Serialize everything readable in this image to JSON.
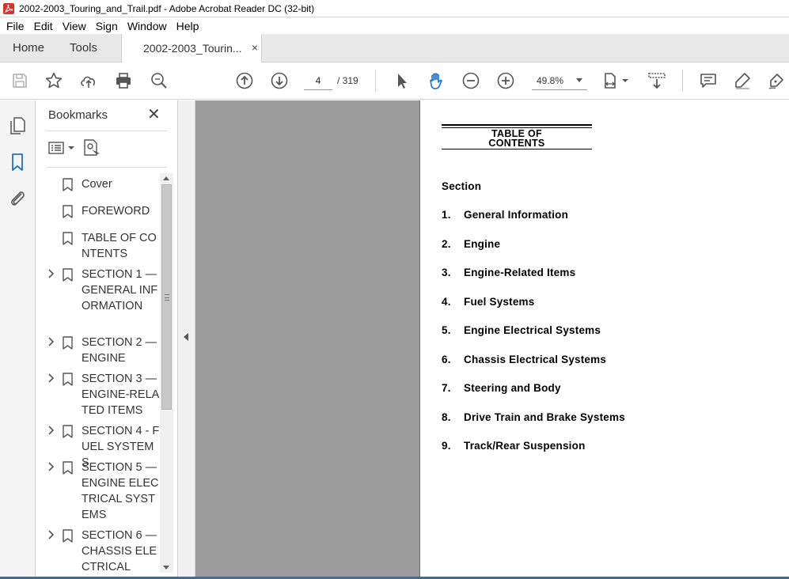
{
  "window": {
    "title": "2002-2003_Touring_and_Trail.pdf - Adobe Acrobat Reader DC (32-bit)"
  },
  "menu": {
    "items": [
      "File",
      "Edit",
      "View",
      "Sign",
      "Window",
      "Help"
    ]
  },
  "tabs": {
    "home": "Home",
    "tools": "Tools",
    "document": "2002-2003_Tourin...",
    "close": "×"
  },
  "toolbar": {
    "current_page": "4",
    "total_pages": "/ 319",
    "zoom": "49.8%"
  },
  "bookmarks": {
    "header": "Bookmarks",
    "close": "✕",
    "items": [
      {
        "label": "Cover"
      },
      {
        "label": "FOREWORD"
      },
      {
        "label": "TABLE OF CONTENTS"
      },
      {
        "label": "SECTION 1 — GENERAL INFORMATION"
      },
      {
        "label": "SECTION 2 — ENGINE"
      },
      {
        "label": "SECTION 3 — ENGINE-RELATED ITEMS"
      },
      {
        "label": "SECTION 4 - FUEL SYSTEMS"
      },
      {
        "label": "SECTION 5 — ENGINE ELECTRICAL SYSTEMS"
      },
      {
        "label": "SECTION 6 — CHASSIS ELECTRICAL"
      }
    ]
  },
  "page": {
    "heading_line1": "TABLE OF",
    "heading_line2": "CONTENTS",
    "section_label": "Section",
    "entries": [
      {
        "num": "1.",
        "title": "General Information"
      },
      {
        "num": "2.",
        "title": "Engine"
      },
      {
        "num": "3.",
        "title": "Engine-Related Items"
      },
      {
        "num": "4.",
        "title": "Fuel Systems"
      },
      {
        "num": "5.",
        "title": "Engine Electrical Systems"
      },
      {
        "num": "6.",
        "title": "Chassis Electrical Systems"
      },
      {
        "num": "7.",
        "title": "Steering and Body"
      },
      {
        "num": "8.",
        "title": "Drive Train and Brake Systems"
      },
      {
        "num": "9.",
        "title": "Track/Rear Suspension"
      }
    ]
  },
  "icons": {
    "save": "save-icon",
    "bookmark_star": "star-icon",
    "upload": "cloud-upload-icon",
    "print": "print-icon",
    "find": "zoom-search-icon",
    "prev_page": "arrow-up-circle-icon",
    "next_page": "arrow-down-circle-icon",
    "select": "pointer-icon",
    "hand": "hand-icon",
    "zoom_out": "zoom-out-icon",
    "zoom_in": "zoom-in-icon",
    "page_fit": "page-fit-icon",
    "scroll_mode": "scroll-mode-icon",
    "comment": "comment-icon",
    "highlight": "highlight-icon",
    "sign": "sign-pen-icon"
  },
  "colors": {
    "accent_blue": "#1a73c6",
    "document_bg": "#9b9b9b"
  }
}
